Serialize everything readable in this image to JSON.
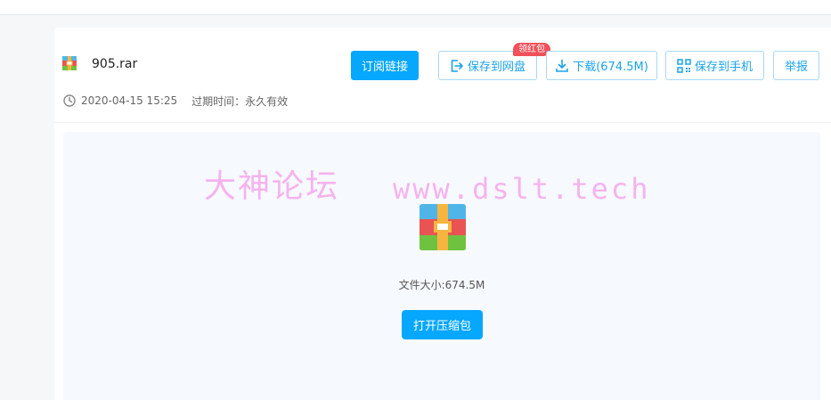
{
  "file": {
    "name": "905.rar",
    "date": "2020-04-15 15:25",
    "expire_label": "过期时间：",
    "expire_value": "永久有效",
    "icon": "winrar-archive-icon"
  },
  "toolbar": {
    "subscribe_label": "订阅链接",
    "save_disk_label": "保存到网盘",
    "save_disk_badge": "领红包",
    "download_label": "下载(674.5M)",
    "save_phone_label": "保存到手机",
    "report_label": "举报"
  },
  "preview": {
    "watermark_cn": "大神论坛",
    "watermark_url": "www.dslt.tech",
    "size_label": "文件大小:",
    "size_value": "674.5M",
    "open_label": "打开压缩包"
  },
  "colors": {
    "accent": "#06a7ff",
    "badge": "#f0515a",
    "watermark": "#f5b3ee"
  }
}
